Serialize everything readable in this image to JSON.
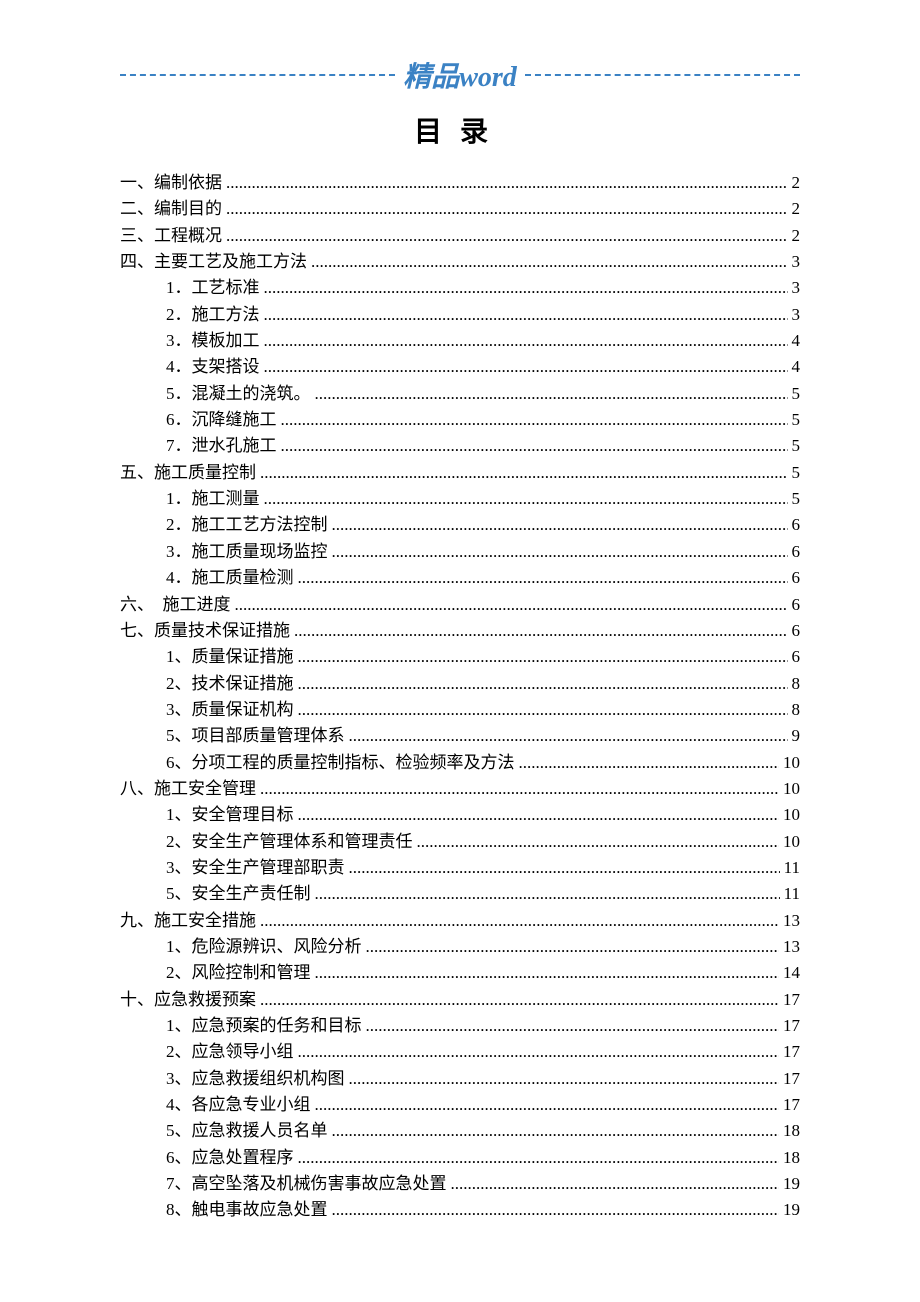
{
  "banner": {
    "left_glyph": "精品",
    "right_glyph": "word"
  },
  "title": "目录",
  "toc": [
    {
      "level": 1,
      "label": "一、编制依据",
      "page": "2"
    },
    {
      "level": 1,
      "label": "二、编制目的",
      "page": "2"
    },
    {
      "level": 1,
      "label": "三、工程概况",
      "page": "2"
    },
    {
      "level": 1,
      "label": "四、主要工艺及施工方法",
      "page": "3"
    },
    {
      "level": 2,
      "label": "1．工艺标准",
      "page": "3"
    },
    {
      "level": 2,
      "label": "2．施工方法",
      "page": "3"
    },
    {
      "level": 2,
      "label": "3．模板加工",
      "page": "4"
    },
    {
      "level": 2,
      "label": "4．支架搭设",
      "page": "4"
    },
    {
      "level": 2,
      "label": "5．混凝土的浇筑。",
      "page": "5"
    },
    {
      "level": 2,
      "label": "6．沉降缝施工",
      "page": "5"
    },
    {
      "level": 2,
      "label": "7．泄水孔施工",
      "page": "5"
    },
    {
      "level": 1,
      "label": "五、施工质量控制",
      "page": "5"
    },
    {
      "level": 2,
      "label": "1．施工测量",
      "page": "5"
    },
    {
      "level": 2,
      "label": "2．施工工艺方法控制",
      "page": "6"
    },
    {
      "level": 2,
      "label": "3．施工质量现场监控",
      "page": "6"
    },
    {
      "level": 2,
      "label": "4．施工质量检测",
      "page": "6"
    },
    {
      "level": 1,
      "label": "六、　施工进度",
      "page": "6"
    },
    {
      "level": 1,
      "label": "七、质量技术保证措施",
      "page": "6"
    },
    {
      "level": 2,
      "label": "1、质量保证措施",
      "page": "6"
    },
    {
      "level": 2,
      "label": "2、技术保证措施",
      "page": "8"
    },
    {
      "level": 2,
      "label": "3、质量保证机构",
      "page": "8"
    },
    {
      "level": 2,
      "label": "5、项目部质量管理体系",
      "page": "9"
    },
    {
      "level": 2,
      "label": "6、分项工程的质量控制指标、检验频率及方法",
      "page": "10"
    },
    {
      "level": 1,
      "label": "八、施工安全管理",
      "page": "10"
    },
    {
      "level": 2,
      "label": "1、安全管理目标",
      "page": "10"
    },
    {
      "level": 2,
      "label": "2、安全生产管理体系和管理责任",
      "page": "10"
    },
    {
      "level": 2,
      "label": "3、安全生产管理部职责",
      "page": "11"
    },
    {
      "level": 2,
      "label": "5、安全生产责任制",
      "page": "11"
    },
    {
      "level": 1,
      "label": "九、施工安全措施",
      "page": "13"
    },
    {
      "level": 2,
      "label": "1、危险源辨识、风险分析",
      "page": "13"
    },
    {
      "level": 2,
      "label": "2、风险控制和管理",
      "page": "14"
    },
    {
      "level": 1,
      "label": "十、应急救援预案",
      "page": "17"
    },
    {
      "level": 2,
      "label": "1、应急预案的任务和目标",
      "page": "17"
    },
    {
      "level": 2,
      "label": "2、应急领导小组",
      "page": "17"
    },
    {
      "level": 2,
      "label": "3、应急救援组织机构图",
      "page": "17"
    },
    {
      "level": 2,
      "label": "4、各应急专业小组",
      "page": "17"
    },
    {
      "level": 2,
      "label": "5、应急救援人员名单",
      "page": "18"
    },
    {
      "level": 2,
      "label": "6、应急处置程序",
      "page": "18"
    },
    {
      "level": 2,
      "label": "7、高空坠落及机械伤害事故应急处置",
      "page": "19"
    },
    {
      "level": 2,
      "label": "8、触电事故应急处置",
      "page": "19"
    }
  ]
}
